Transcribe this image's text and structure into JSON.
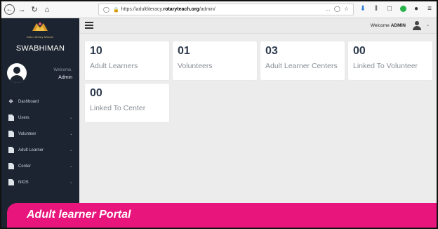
{
  "browser": {
    "url_prefix": "https://adultliteracy.",
    "url_domain": "rotaryteach.org",
    "url_path": "/admin/",
    "page_actions": "…",
    "icons": [
      "back-icon",
      "forward-icon",
      "reload-icon",
      "home-icon",
      "shield-icon",
      "lock-icon",
      "bookmark-star-icon",
      "download-icon",
      "library-icon",
      "reader-icon",
      "extension-icon",
      "account-icon",
      "menu-icon"
    ]
  },
  "sidebar": {
    "logo_caption": "India Literacy Mission",
    "brand": "SWABHIMAN",
    "welcome": "Welcome,",
    "user": "Admin",
    "items": [
      {
        "label": "Dashboard",
        "icon": "home-icon",
        "expandable": false
      },
      {
        "label": "Users",
        "icon": "file-icon",
        "expandable": true
      },
      {
        "label": "Volunteer",
        "icon": "file-icon",
        "expandable": true
      },
      {
        "label": "Adult Learner",
        "icon": "file-icon",
        "expandable": true
      },
      {
        "label": "Center",
        "icon": "file-icon",
        "expandable": true
      },
      {
        "label": "NIOS",
        "icon": "file-icon",
        "expandable": true
      }
    ]
  },
  "topbar": {
    "welcome": "Welcome",
    "user": "ADMIN"
  },
  "cards": [
    {
      "value": "10",
      "label": "Adult Learners"
    },
    {
      "value": "01",
      "label": "Volunteers"
    },
    {
      "value": "03",
      "label": "Adult Learner Centers"
    },
    {
      "value": "00",
      "label": "Linked To Volunteer"
    },
    {
      "value": "00",
      "label": "Linked To Center"
    }
  ],
  "banner": {
    "text": "Adult learner Portal",
    "color": "#e8157c"
  },
  "colors": {
    "sidebar_bg": "#1b2430",
    "content_bg": "#ececec",
    "card_value": "#2c3a4d",
    "card_label": "#8a8f97"
  }
}
